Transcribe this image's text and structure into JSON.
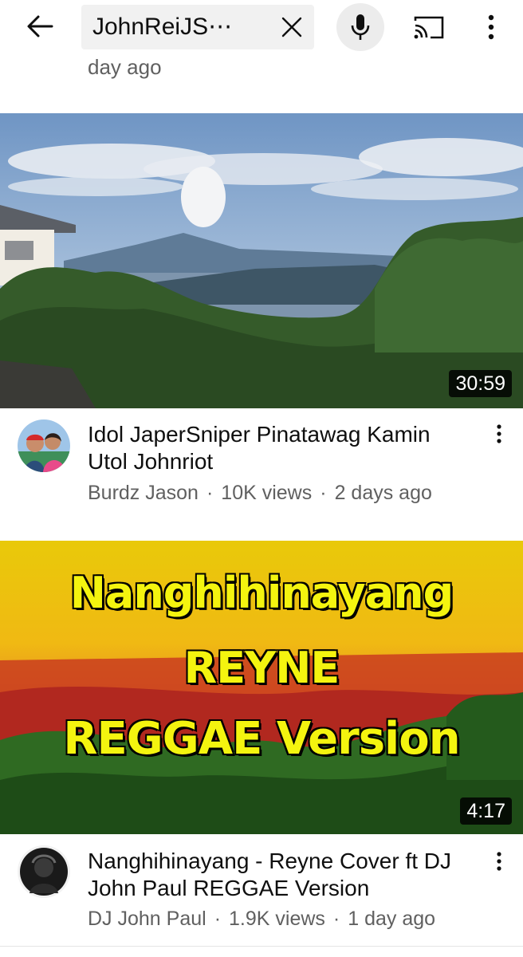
{
  "topbar": {
    "search_query": "JohnReiJS⋯"
  },
  "previous_item": {
    "meta_tail": "day ago"
  },
  "videos": [
    {
      "title": "Idol JaperSniper Pinatawag Kamin Utol Johnriot",
      "channel": "Burdz Jason",
      "views": "10K views",
      "age": "2 days ago",
      "duration": "30:59"
    },
    {
      "title": "Nanghihinayang - Reyne Cover ft DJ John Paul REGGAE Version",
      "channel": "DJ John Paul",
      "views": "1.9K views",
      "age": "1 day ago",
      "duration": "4:17",
      "thumbnail_text": [
        "Nanghihinayang",
        "REYNE",
        "REGGAE Version"
      ]
    }
  ],
  "icons": {
    "back": "arrow-left-icon",
    "clear": "close-icon",
    "mic": "microphone-icon",
    "cast": "cast-icon",
    "more": "more-vertical-icon"
  },
  "colors": {
    "meta_gray": "#606060",
    "thumbnail_text_yellow": "#f4f40f"
  }
}
